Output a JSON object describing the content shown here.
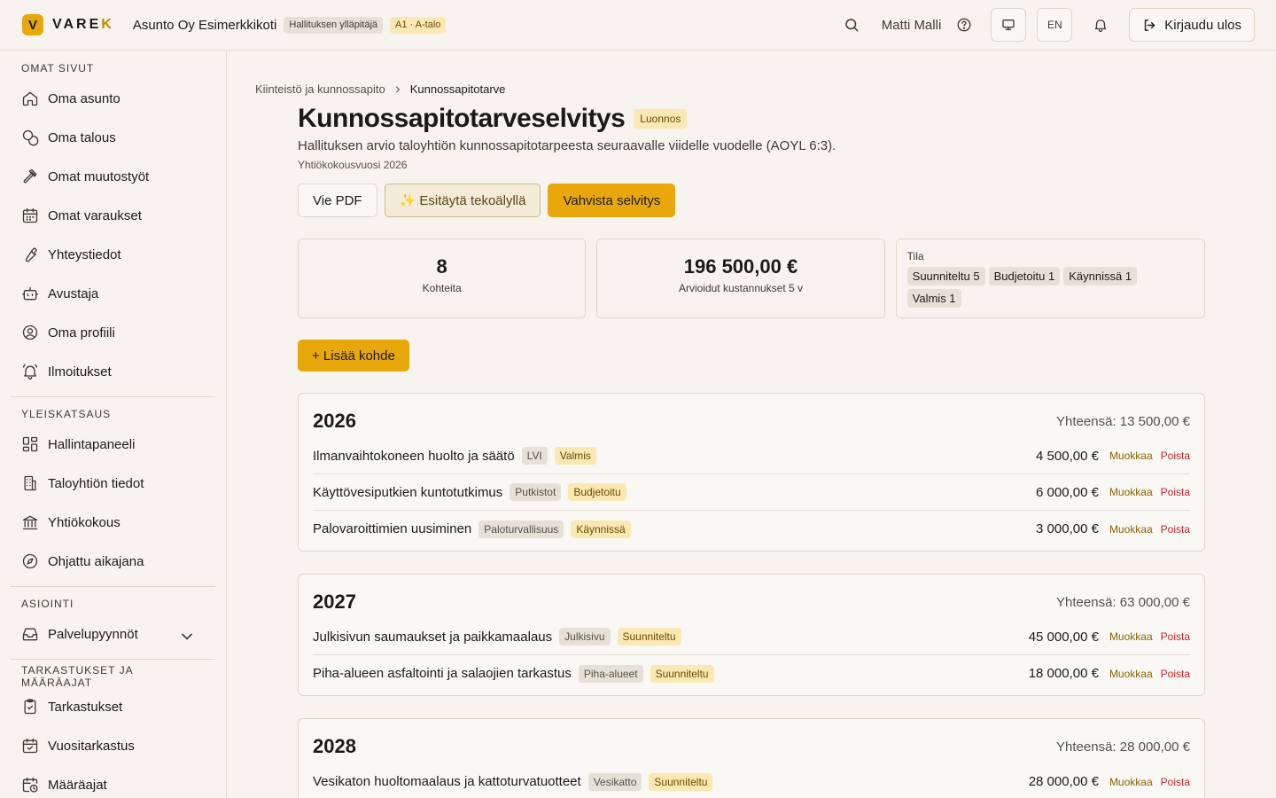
{
  "header": {
    "logo_letter": "V",
    "logo_text_main": "VARE",
    "logo_text_accent": "K",
    "org_name": "Asunto Oy Esimerkkikoti",
    "role_chip": "Hallituksen ylläpitäjä",
    "unit_chip": "A1 · A-talo",
    "user_name": "Matti Malli",
    "lang_label": "EN",
    "logout_label": "Kirjaudu ulos",
    "accent_color": "#e8a80c"
  },
  "sidebar": {
    "sections": [
      {
        "title": "OMAT SIVUT",
        "items": [
          {
            "label": "Oma asunto",
            "icon": "home-icon"
          },
          {
            "label": "Oma talous",
            "icon": "coins-icon"
          },
          {
            "label": "Omat muutostyöt",
            "icon": "hammer-icon"
          },
          {
            "label": "Omat varaukset",
            "icon": "calendar-icon"
          },
          {
            "label": "Yhteystiedot",
            "icon": "wrench-icon"
          },
          {
            "label": "Avustaja",
            "icon": "bot-icon"
          },
          {
            "label": "Oma profiili",
            "icon": "user-circle-icon"
          },
          {
            "label": "Ilmoitukset",
            "icon": "bell-ring-icon"
          }
        ]
      },
      {
        "title": "YLEISKATSAUS",
        "items": [
          {
            "label": "Hallintapaneeli",
            "icon": "dashboard-icon"
          },
          {
            "label": "Taloyhtiön tiedot",
            "icon": "building-icon"
          },
          {
            "label": "Yhtiökokous",
            "icon": "landmark-icon"
          },
          {
            "label": "Ohjattu aikajana",
            "icon": "compass-icon"
          }
        ]
      },
      {
        "title": "ASIOINTI",
        "items": [
          {
            "label": "Palvelupyynnöt",
            "icon": "inbox-icon"
          }
        ]
      },
      {
        "title": "TARKASTUKSET JA MÄÄRÄAJAT",
        "items": [
          {
            "label": "Tarkastukset",
            "icon": "clipboard-check-icon"
          },
          {
            "label": "Vuositarkastus",
            "icon": "calendar-check-icon"
          },
          {
            "label": "Määräajat",
            "icon": "calendar-clock-icon"
          }
        ]
      }
    ]
  },
  "breadcrumb": {
    "parent": "Kiinteistö ja kunnossapito",
    "current": "Kunnossapitotarve"
  },
  "page": {
    "title": "Kunnossapitotarveselvitys",
    "status_badge": "Luonnos",
    "description": "Hallituksen arvio taloyhtiön kunnossapitotarpeesta seuraavalle viidelle vuodelle (AOYL 6:3).",
    "meeting_year": "Yhtiökokousvuosi 2026",
    "export_pdf_label": "Vie PDF",
    "ai_prefill_label": "✨ Esitäytä tekoälyllä",
    "confirm_label": "Vahvista selvitys",
    "add_item_label": "+ Lisää kohde"
  },
  "stats": {
    "items_count": "8",
    "items_label": "Kohteita",
    "cost_total": "196 500,00 €",
    "cost_label": "Arvioidut kustannukset 5 v",
    "status_title": "Tila",
    "status_chips": [
      "Suunniteltu 5",
      "Budjetoitu 1",
      "Käynnissä 1",
      "Valmis 1"
    ]
  },
  "edit_label": "Muokkaa",
  "delete_label": "Poista",
  "years": [
    {
      "year": "2026",
      "total": "Yhteensä: 13 500,00 €",
      "items": [
        {
          "name": "Ilmanvaihtokoneen huolto ja säätö",
          "category": "LVI",
          "status": "Valmis",
          "amount": "4 500,00 €"
        },
        {
          "name": "Käyttövesiputkien kuntotutkimus",
          "category": "Putkistot",
          "status": "Budjetoitu",
          "amount": "6 000,00 €"
        },
        {
          "name": "Palovaroittimien uusiminen",
          "category": "Paloturvallisuus",
          "status": "Käynnissä",
          "amount": "3 000,00 €"
        }
      ]
    },
    {
      "year": "2027",
      "total": "Yhteensä: 63 000,00 €",
      "items": [
        {
          "name": "Julkisivun saumaukset ja paikkamaalaus",
          "category": "Julkisivu",
          "status": "Suunniteltu",
          "amount": "45 000,00 €"
        },
        {
          "name": "Piha-alueen asfaltointi ja salaojien tarkastus",
          "category": "Piha-alueet",
          "status": "Suunniteltu",
          "amount": "18 000,00 €"
        }
      ]
    },
    {
      "year": "2028",
      "total": "Yhteensä: 28 000,00 €",
      "items": [
        {
          "name": "Vesikaton huoltomaalaus ja kattoturvatuotteet",
          "category": "Vesikatto",
          "status": "Suunniteltu",
          "amount": "28 000,00 €"
        }
      ]
    }
  ]
}
